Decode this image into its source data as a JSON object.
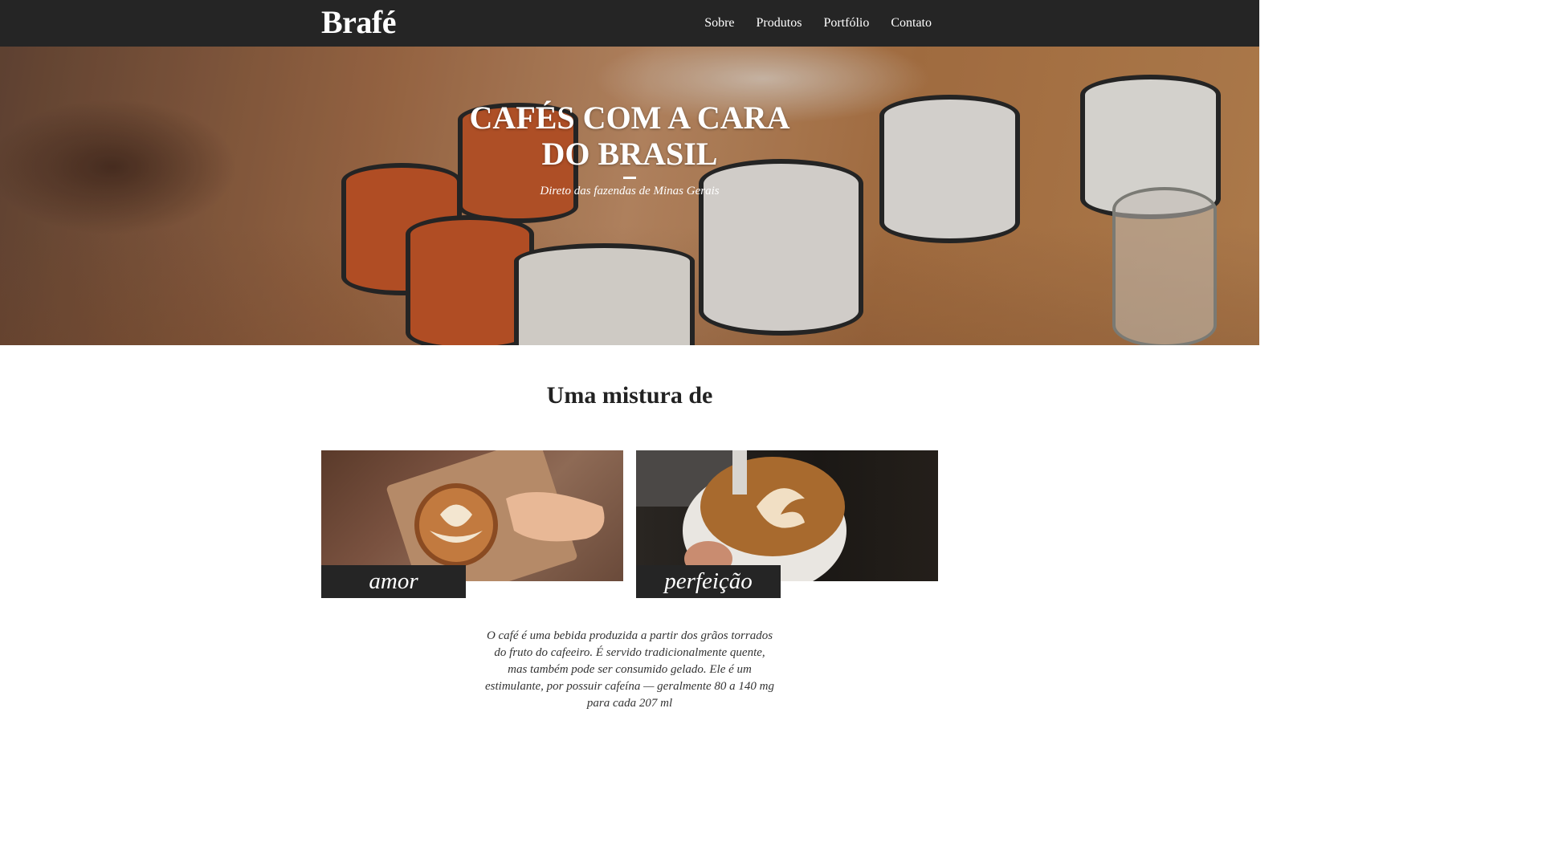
{
  "header": {
    "brand": "Brafé",
    "nav": [
      "Sobre",
      "Produtos",
      "Portfólio",
      "Contato"
    ]
  },
  "hero": {
    "title_line1": "CAFÉS COM A CARA",
    "title_line2": "DO BRASIL",
    "subtitle": "Direto das fazendas de Minas Gerais"
  },
  "section": {
    "title": "Uma mistura de",
    "cards": [
      {
        "label": "amor"
      },
      {
        "label": "perfeição"
      }
    ],
    "paragraph": "O café é uma bebida produzida a partir dos grãos torrados do fruto do cafeeiro. É servido tradicionalmente quente, mas também pode ser consumido gelado. Ele é um estimulante, por possuir cafeína — geralmente 80 a 140 mg para cada 207 ml"
  },
  "colors": {
    "header_bg": "#252525",
    "label_bg": "#252525",
    "text": "#222222"
  }
}
